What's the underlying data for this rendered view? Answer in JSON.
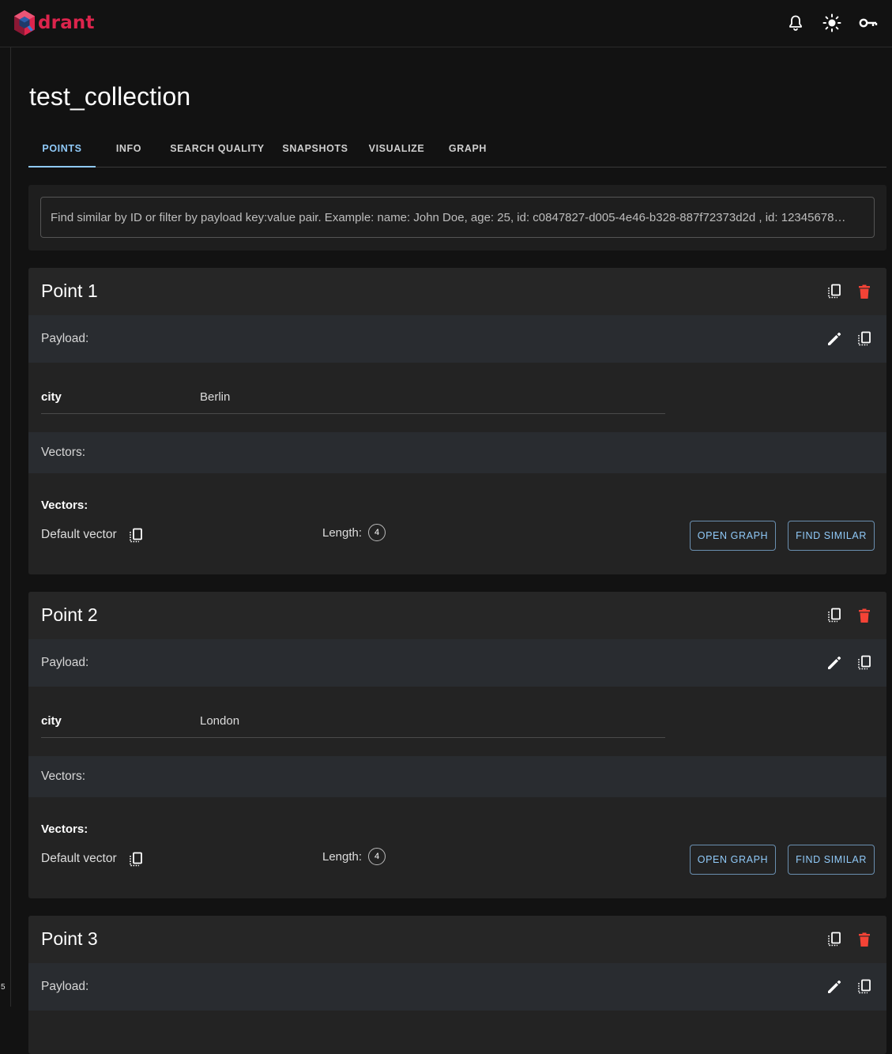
{
  "app": {
    "logo_text": "drant",
    "brand_color": "#dc244c"
  },
  "header": {
    "icons": [
      "bell-icon",
      "sun-icon",
      "key-icon"
    ]
  },
  "rail": {
    "number": "5"
  },
  "page": {
    "title": "test_collection"
  },
  "tabs": [
    {
      "label": "POINTS",
      "active": true
    },
    {
      "label": "INFO",
      "active": false
    },
    {
      "label": "SEARCH QUALITY",
      "active": false
    },
    {
      "label": "SNAPSHOTS",
      "active": false
    },
    {
      "label": "VISUALIZE",
      "active": false
    },
    {
      "label": "GRAPH",
      "active": false
    }
  ],
  "search": {
    "placeholder": "Find similar by ID or filter by payload key:value pair. Example: name: John Doe, age: 25, id: c0847827-d005-4e46-b328-887f72373d2d , id: 12345678…"
  },
  "labels": {
    "payload": "Payload:",
    "vectors": "Vectors:",
    "default_vector": "Default vector",
    "length": "Length:",
    "open_graph": "OPEN GRAPH",
    "find_similar": "FIND SIMILAR"
  },
  "points": [
    {
      "title": "Point 1",
      "payload": {
        "key": "city",
        "value": "Berlin"
      },
      "vector_length": "4"
    },
    {
      "title": "Point 2",
      "payload": {
        "key": "city",
        "value": "London"
      },
      "vector_length": "4"
    },
    {
      "title": "Point 3"
    }
  ],
  "colors": {
    "accent": "#90caf9",
    "delete": "#f44336",
    "background": "#121212",
    "card": "#232323"
  }
}
